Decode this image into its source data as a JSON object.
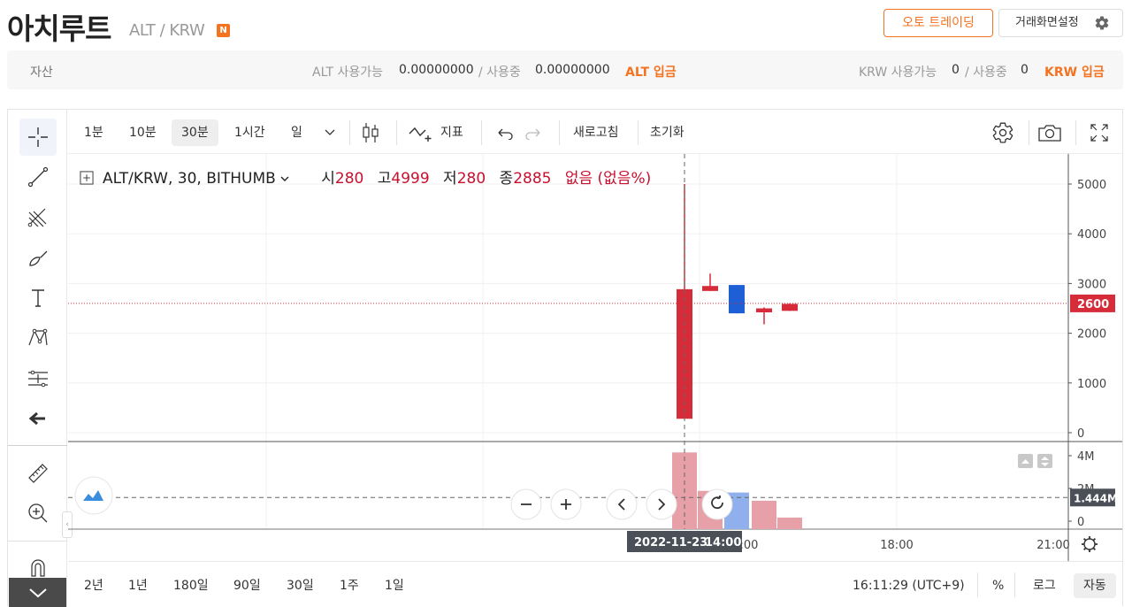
{
  "header": {
    "coin_name": "아치루트",
    "pair": "ALT / KRW",
    "new_badge": "N",
    "auto_trading": "오토 트레이딩",
    "screen_setting": "거래화면설정"
  },
  "assets": {
    "label": "자산",
    "alt_available_label": "ALT 사용가능",
    "alt_available": "0.00000000",
    "alt_in_use_label": "/ 사용중",
    "alt_in_use": "0.00000000",
    "alt_deposit": "ALT 입금",
    "krw_available_label": "KRW 사용가능",
    "krw_available": "0",
    "krw_in_use_label": "/ 사용중",
    "krw_in_use": "0",
    "krw_deposit": "KRW 입금"
  },
  "toolbar": {
    "intervals": [
      "1분",
      "10분",
      "30분",
      "1시간",
      "일"
    ],
    "active_interval": "30분",
    "indicator": "지표",
    "refresh": "새로고침",
    "reset": "초기화"
  },
  "legend": {
    "symbol": "ALT/KRW, 30, BITHUMB",
    "open_label": "시",
    "open": "280",
    "high_label": "고",
    "high": "4999",
    "low_label": "저",
    "low": "280",
    "close_label": "종",
    "close": "2885",
    "change": "없음 (없음%)"
  },
  "chart_data": {
    "type": "candlestick",
    "price_axis": {
      "ticks": [
        "5000",
        "4000",
        "3000",
        "2000",
        "1000",
        "0"
      ],
      "range": [
        0,
        5400
      ]
    },
    "current_price_label": "2600",
    "current_price": 2600,
    "candles": [
      {
        "open": 280,
        "high": 4999,
        "low": 280,
        "close": 2885,
        "direction": "up"
      },
      {
        "open": 2850,
        "high": 3200,
        "low": 2850,
        "close": 2950,
        "direction": "up"
      },
      {
        "open": 2970,
        "high": 2970,
        "low": 2400,
        "close": 2400,
        "direction": "down"
      },
      {
        "open": 2420,
        "high": 2520,
        "low": 2180,
        "close": 2500,
        "direction": "up"
      },
      {
        "open": 2450,
        "high": 2600,
        "low": 2450,
        "close": 2590,
        "direction": "up"
      }
    ],
    "volume_axis": {
      "ticks": [
        "4M",
        "2M",
        "0"
      ],
      "range": [
        0,
        4800000
      ]
    },
    "volume_label": "1.444M",
    "volume_level": 1444000,
    "volumes": [
      {
        "value": 4200000,
        "direction": "up"
      },
      {
        "value": 1850000,
        "direction": "up"
      },
      {
        "value": 1750000,
        "direction": "down"
      },
      {
        "value": 1250000,
        "direction": "up"
      },
      {
        "value": 220000,
        "direction": "up"
      }
    ],
    "time_axis": {
      "labels": [
        ":00",
        "18:00",
        "21:00"
      ]
    },
    "crosshair_date": "2022-11-23",
    "crosshair_time": "14:00",
    "colors": {
      "up": "#d62c3a",
      "down": "#1f5fd6",
      "up_volume": "#e8a0a8",
      "down_volume": "#8fb0ec",
      "price_line": "#d62c3a"
    }
  },
  "bottom": {
    "ranges": [
      "2년",
      "1년",
      "180일",
      "90일",
      "30일",
      "1주",
      "1일"
    ],
    "clock": "16:11:29 (UTC+9)",
    "percent": "%",
    "log": "로그",
    "auto": "자동"
  }
}
